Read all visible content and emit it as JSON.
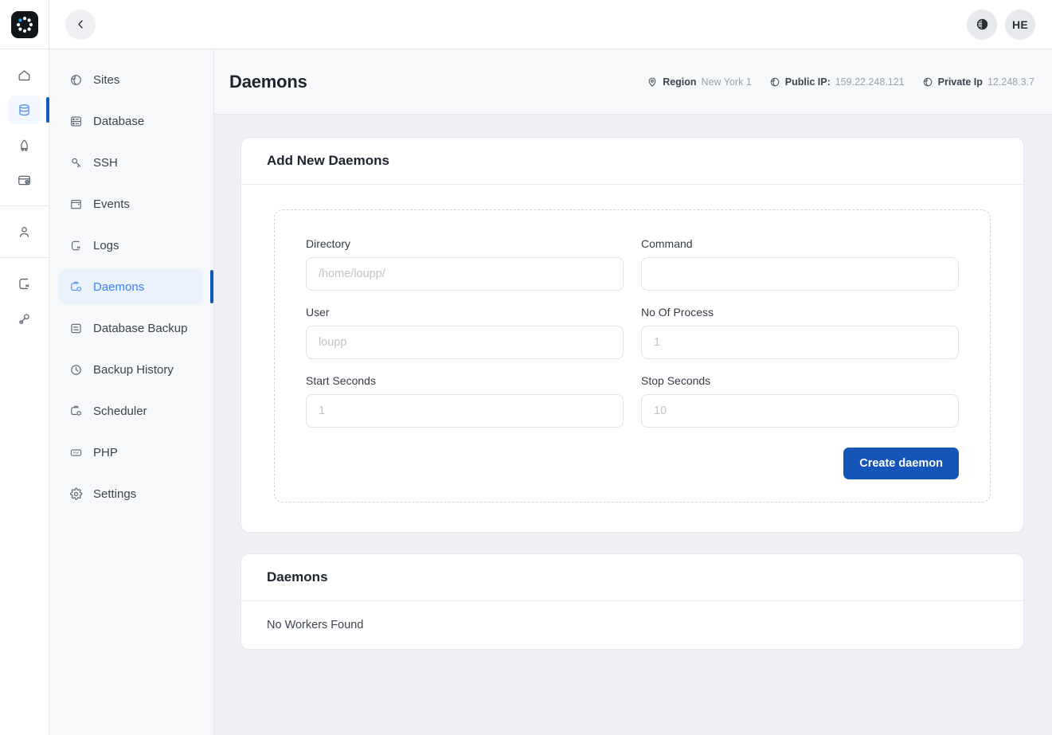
{
  "brand": {
    "logo_name": "app-logo",
    "accent_blue": "#1557c0",
    "active_blue": "#3b82f6",
    "button_blue": "#1355b8"
  },
  "topbar": {
    "back_label": "‹",
    "theme_toggle_name": "theme-toggle",
    "avatar_initials": "HE"
  },
  "rail": {
    "items": [
      {
        "name": "home-icon",
        "label": "Home",
        "active": false
      },
      {
        "name": "servers-icon",
        "label": "Servers",
        "active": true
      },
      {
        "name": "rocket-icon",
        "label": "Deployments",
        "active": false
      },
      {
        "name": "billing-icon",
        "label": "Billing",
        "active": false
      }
    ],
    "account_items": [
      {
        "name": "user-icon",
        "label": "Account"
      }
    ],
    "bottom_items": [
      {
        "name": "logs-icon",
        "label": "Logs"
      },
      {
        "name": "key-icon",
        "label": "SSH Keys"
      }
    ]
  },
  "subnav": {
    "items": [
      {
        "label": "Sites",
        "icon": "globe-icon",
        "active": false
      },
      {
        "label": "Database",
        "icon": "database-icon",
        "active": false
      },
      {
        "label": "SSH",
        "icon": "key-icon",
        "active": false
      },
      {
        "label": "Events",
        "icon": "calendar-icon",
        "active": false
      },
      {
        "label": "Logs",
        "icon": "logs-icon",
        "active": false
      },
      {
        "label": "Daemons",
        "icon": "daemon-icon",
        "active": true
      },
      {
        "label": "Database Backup",
        "icon": "database-backup-icon",
        "active": false
      },
      {
        "label": "Backup History",
        "icon": "history-icon",
        "active": false
      },
      {
        "label": "Scheduler",
        "icon": "scheduler-icon",
        "active": false
      },
      {
        "label": "PHP",
        "icon": "php-icon",
        "active": false
      },
      {
        "label": "Settings",
        "icon": "gear-icon",
        "active": false
      }
    ]
  },
  "page": {
    "title": "Daemons",
    "meta": [
      {
        "icon": "location-pin-icon",
        "label": "Region",
        "value": "New York 1"
      },
      {
        "icon": "globe-icon",
        "label": "Public IP:",
        "value": "159.22.248.121"
      },
      {
        "icon": "globe-icon",
        "label": "Private Ip",
        "value": "12.248.3.7"
      }
    ]
  },
  "add_card": {
    "title": "Add New Daemons",
    "fields": [
      {
        "label": "Directory",
        "value": "",
        "placeholder": "/home/loupp/",
        "name": "directory-input"
      },
      {
        "label": "Command",
        "value": "",
        "placeholder": "",
        "name": "command-input"
      },
      {
        "label": "User",
        "value": "",
        "placeholder": "loupp",
        "name": "user-input"
      },
      {
        "label": "No Of Process",
        "value": "",
        "placeholder": "1",
        "name": "no-of-process-input"
      },
      {
        "label": "Start Seconds",
        "value": "",
        "placeholder": "1",
        "name": "start-seconds-input"
      },
      {
        "label": "Stop Seconds",
        "value": "",
        "placeholder": "10",
        "name": "stop-seconds-input"
      }
    ],
    "submit_label": "Create daemon"
  },
  "list_card": {
    "title": "Daemons",
    "empty_text": "No Workers Found"
  }
}
